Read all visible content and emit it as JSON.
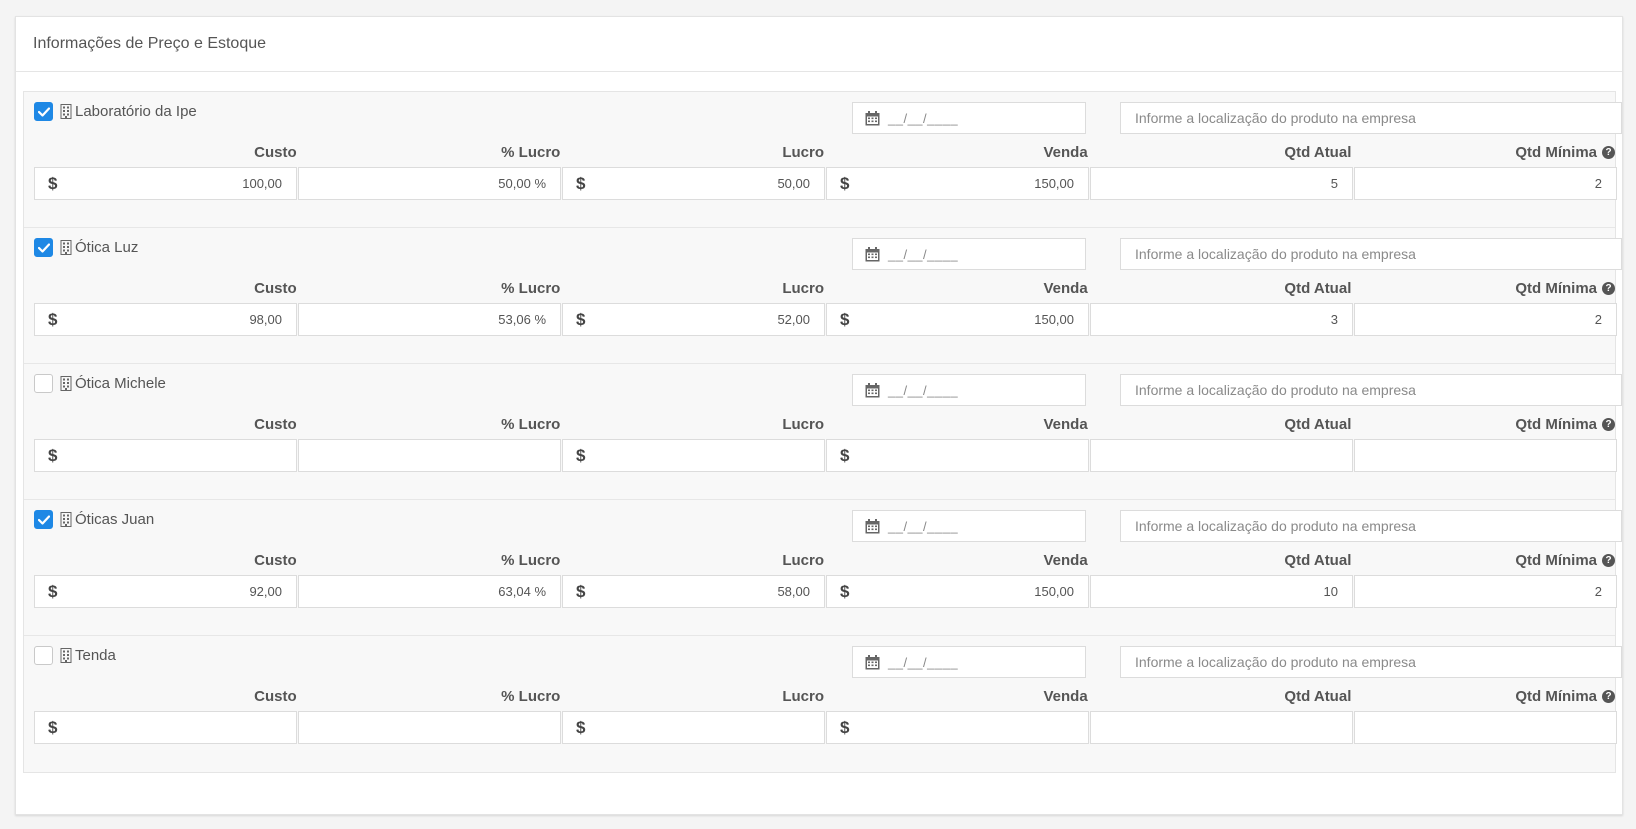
{
  "panel": {
    "title": "Informações de Preço e Estoque"
  },
  "labels": {
    "custo": "Custo",
    "lucro_pct": "% Lucro",
    "lucro": "Lucro",
    "venda": "Venda",
    "qtd_atual": "Qtd Atual",
    "qtd_minima": "Qtd Mínima",
    "help": "?"
  },
  "date_placeholder": "__/__/____",
  "location_placeholder": "Informe a localização do produto na empresa",
  "currency_symbol": "$",
  "colors": {
    "checkbox_checked": "#1e88e5"
  },
  "stores": [
    {
      "name": "Laboratório da Ipe",
      "checked": true,
      "custo": "100,00",
      "lucro_pct": "50,00 %",
      "lucro": "50,00",
      "venda": "150,00",
      "qtd_atual": "5",
      "qtd_minima": "2"
    },
    {
      "name": "Ótica Luz",
      "checked": true,
      "custo": "98,00",
      "lucro_pct": "53,06 %",
      "lucro": "52,00",
      "venda": "150,00",
      "qtd_atual": "3",
      "qtd_minima": "2"
    },
    {
      "name": "Ótica Michele",
      "checked": false,
      "custo": "",
      "lucro_pct": "",
      "lucro": "",
      "venda": "",
      "qtd_atual": "",
      "qtd_minima": ""
    },
    {
      "name": "Óticas Juan",
      "checked": true,
      "custo": "92,00",
      "lucro_pct": "63,04 %",
      "lucro": "58,00",
      "venda": "150,00",
      "qtd_atual": "10",
      "qtd_minima": "2"
    },
    {
      "name": "Tenda",
      "checked": false,
      "custo": "",
      "lucro_pct": "",
      "lucro": "",
      "venda": "",
      "qtd_atual": "",
      "qtd_minima": ""
    }
  ]
}
